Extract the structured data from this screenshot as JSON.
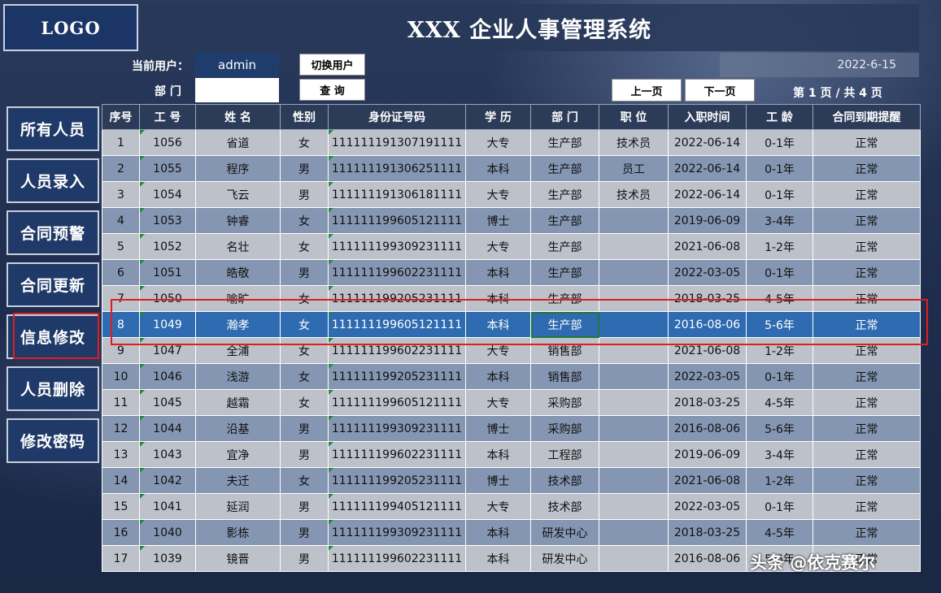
{
  "header": {
    "logo": "LOGO",
    "title": "XXX 企业人事管理系统"
  },
  "toolbar": {
    "current_user_label": "当前用户：",
    "current_user": "admin",
    "switch_user_label": "切换用户",
    "dept_label": "部 门",
    "dept_value": "",
    "query_label": "查 询",
    "date": "2022-6-15",
    "prev_label": "上一页",
    "next_label": "下一页",
    "page_info": "第 1 页 / 共 4 页"
  },
  "nav": [
    {
      "label": "所有人员"
    },
    {
      "label": "人员录入"
    },
    {
      "label": "合同预警"
    },
    {
      "label": "合同更新"
    },
    {
      "label": "信息修改"
    },
    {
      "label": "人员删除"
    },
    {
      "label": "修改密码"
    }
  ],
  "table": {
    "columns": [
      "序号",
      "工 号",
      "姓 名",
      "性别",
      "身份证号码",
      "学 历",
      "部 门",
      "职 位",
      "入职时间",
      "工 龄",
      "合同到期提醒"
    ],
    "rows": [
      [
        "1",
        "1056",
        "省道",
        "女",
        "111111191307191111",
        "大专",
        "生产部",
        "技术员",
        "2022-06-14",
        "0-1年",
        "正常"
      ],
      [
        "2",
        "1055",
        "程序",
        "男",
        "111111191306251111",
        "本科",
        "生产部",
        "员工",
        "2022-06-14",
        "0-1年",
        "正常"
      ],
      [
        "3",
        "1054",
        "飞云",
        "男",
        "111111191306181111",
        "大专",
        "生产部",
        "技术员",
        "2022-06-14",
        "0-1年",
        "正常"
      ],
      [
        "4",
        "1053",
        "钟睿",
        "女",
        "111111199605121111",
        "博士",
        "生产部",
        "",
        "2019-06-09",
        "3-4年",
        "正常"
      ],
      [
        "5",
        "1052",
        "名壮",
        "女",
        "111111199309231111",
        "大专",
        "生产部",
        "",
        "2021-06-08",
        "1-2年",
        "正常"
      ],
      [
        "6",
        "1051",
        "皓敬",
        "男",
        "111111199602231111",
        "本科",
        "生产部",
        "",
        "2022-03-05",
        "0-1年",
        "正常"
      ],
      [
        "7",
        "1050",
        "喻旷",
        "女",
        "111111199205231111",
        "本科",
        "生产部",
        "",
        "2018-03-25",
        "4-5年",
        "正常"
      ],
      [
        "8",
        "1049",
        "瀚孝",
        "女",
        "111111199605121111",
        "本科",
        "生产部",
        "",
        "2016-08-06",
        "5-6年",
        "正常"
      ],
      [
        "9",
        "1047",
        "全浦",
        "女",
        "111111199602231111",
        "大专",
        "销售部",
        "",
        "2021-06-08",
        "1-2年",
        "正常"
      ],
      [
        "10",
        "1046",
        "浅游",
        "女",
        "111111199205231111",
        "本科",
        "销售部",
        "",
        "2022-03-05",
        "0-1年",
        "正常"
      ],
      [
        "11",
        "1045",
        "越霜",
        "女",
        "111111199605121111",
        "大专",
        "采购部",
        "",
        "2018-03-25",
        "4-5年",
        "正常"
      ],
      [
        "12",
        "1044",
        "沿基",
        "男",
        "111111199309231111",
        "博士",
        "采购部",
        "",
        "2016-08-06",
        "5-6年",
        "正常"
      ],
      [
        "13",
        "1043",
        "宜净",
        "男",
        "111111199602231111",
        "本科",
        "工程部",
        "",
        "2019-06-09",
        "3-4年",
        "正常"
      ],
      [
        "14",
        "1042",
        "夫迁",
        "女",
        "111111199205231111",
        "博士",
        "技术部",
        "",
        "2021-06-08",
        "1-2年",
        "正常"
      ],
      [
        "15",
        "1041",
        "延润",
        "男",
        "111111199405121111",
        "大专",
        "技术部",
        "",
        "2022-03-05",
        "0-1年",
        "正常"
      ],
      [
        "16",
        "1040",
        "影栋",
        "男",
        "111111199309231111",
        "本科",
        "研发中心",
        "",
        "2018-03-25",
        "4-5年",
        "正常"
      ],
      [
        "17",
        "1039",
        "镜晋",
        "男",
        "111111199602231111",
        "本科",
        "研发中心",
        "",
        "2016-08-06",
        "5-6年",
        "正常"
      ]
    ]
  },
  "watermark": "头条 @依克赛尔",
  "colors": {
    "selected_row": "#2f6bb0",
    "highlight": "#e01e1e",
    "header_bg": "#2c3b58"
  }
}
